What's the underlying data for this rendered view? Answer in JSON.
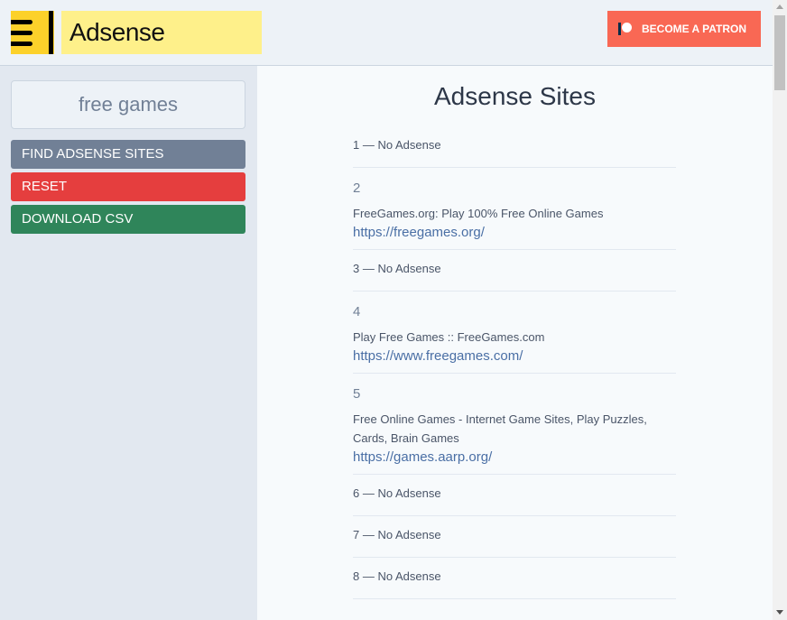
{
  "header": {
    "title": "Adsense Checker",
    "patron_label": "BECOME A PATRON"
  },
  "sidebar": {
    "search_value": "free games",
    "find_label": "FIND ADSENSE SITES",
    "reset_label": "RESET",
    "download_label": "DOWNLOAD CSV"
  },
  "colors": {
    "find": "#718096",
    "reset": "#e53e3e",
    "download": "#2f855a"
  },
  "main": {
    "heading": "Adsense Sites",
    "results": [
      {
        "text": "1 — No Adsense"
      },
      {
        "num": "2",
        "title": "FreeGames.org: Play 100% Free Online Games",
        "url": "https://freegames.org/"
      },
      {
        "text": "3 — No Adsense"
      },
      {
        "num": "4",
        "title": "Play Free Games :: FreeGames.com",
        "url": "https://www.freegames.com/"
      },
      {
        "num": "5",
        "title": "Free Online Games - Internet Game Sites, Play Puzzles, Cards, Brain Games",
        "url": "https://games.aarp.org/"
      },
      {
        "text": "6 — No Adsense"
      },
      {
        "text": "7 — No Adsense"
      },
      {
        "text": "8 — No Adsense"
      }
    ]
  }
}
